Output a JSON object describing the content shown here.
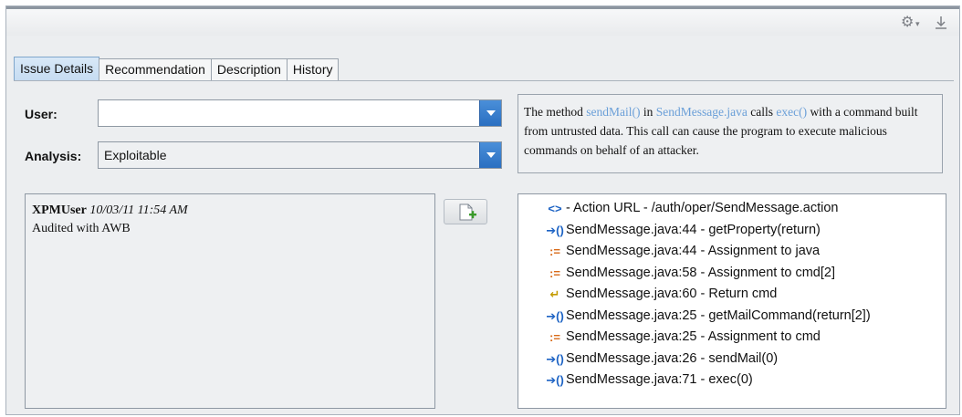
{
  "tabs": [
    {
      "label": "Issue Details",
      "active": true
    },
    {
      "label": "Recommendation",
      "active": false
    },
    {
      "label": "Description",
      "active": false
    },
    {
      "label": "History",
      "active": false
    }
  ],
  "fields": {
    "user_label": "User:",
    "user_value": "",
    "analysis_label": "Analysis:",
    "analysis_value": "Exploitable"
  },
  "description": {
    "p1": "The method ",
    "link1": "sendMail()",
    "p2": " in ",
    "link2": "SendMessage.java",
    "p3": " calls ",
    "link3": "exec()",
    "p4": " with a command built from untrusted data. This call can cause the program to execute malicious commands on behalf of an attacker."
  },
  "comment": {
    "user": "XPMUser",
    "timestamp": "10/03/11 11:54 AM",
    "text": "Audited with AWB"
  },
  "trace": [
    {
      "icon": "action-url-icon",
      "glyph": "<>",
      "text": " - Action URL - /auth/oper/SendMessage.action"
    },
    {
      "icon": "call-icon",
      "glyph": "➔()",
      "text": "SendMessage.java:44 - getProperty(return)"
    },
    {
      "icon": "assignment-icon",
      "glyph": ":=",
      "text": "SendMessage.java:44 - Assignment to java"
    },
    {
      "icon": "assignment-icon",
      "glyph": ":=",
      "text": "SendMessage.java:58 - Assignment to cmd[2]"
    },
    {
      "icon": "return-icon",
      "glyph": "↵",
      "text": "SendMessage.java:60 - Return cmd"
    },
    {
      "icon": "call-icon",
      "glyph": "➔()",
      "text": "SendMessage.java:25 - getMailCommand(return[2])"
    },
    {
      "icon": "assignment-icon",
      "glyph": ":=",
      "text": "SendMessage.java:25 - Assignment to cmd"
    },
    {
      "icon": "call-icon",
      "glyph": "➔()",
      "text": "SendMessage.java:26 - sendMail(0)"
    },
    {
      "icon": "call-icon",
      "glyph": "➔()",
      "text": "SendMessage.java:71 - exec(0)"
    }
  ],
  "colors": {
    "link": "#6a9fd8",
    "dropdown_arrow": "#2a6fc1",
    "active_tab": "#c6dcf2"
  }
}
